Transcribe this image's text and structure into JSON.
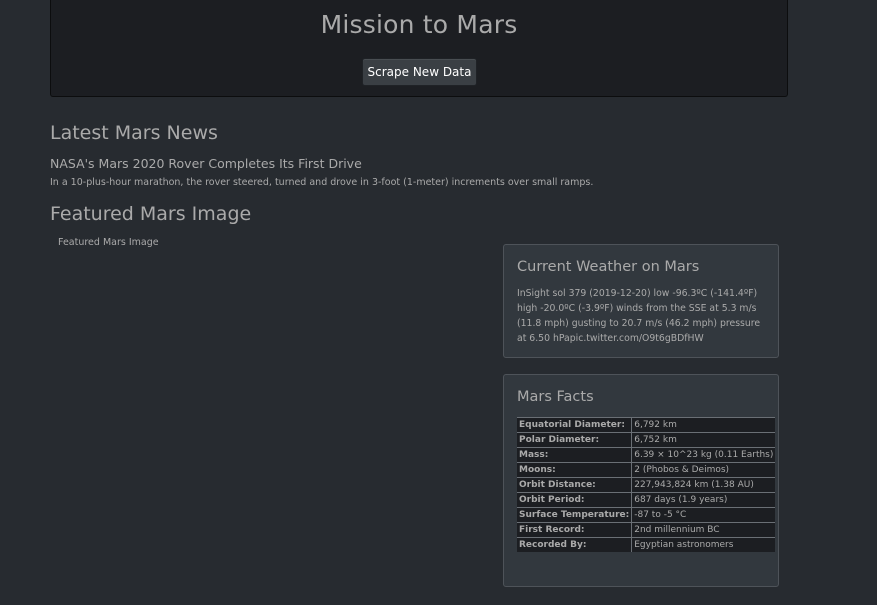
{
  "header": {
    "title": "Mission to Mars",
    "scrape_button_label": "Scrape New Data"
  },
  "news": {
    "section_title": "Latest Mars News",
    "headline": "NASA's Mars 2020 Rover Completes Its First Drive",
    "teaser": "In a 10-plus-hour marathon, the rover steered, turned and drove in 3-foot (1-meter) increments over small ramps."
  },
  "featured_image": {
    "section_title": "Featured Mars Image",
    "alt_text": "Featured Mars Image"
  },
  "weather": {
    "title": "Current Weather on Mars",
    "text": "InSight sol 379 (2019-12-20) low -96.3ºC (-141.4ºF) high -20.0ºC (-3.9ºF) winds from the SSE at 5.3 m/s (11.8 mph) gusting to 20.7 m/s (46.2 mph) pressure at 6.50 hPapic.twitter.com/O9t6gBDfHW"
  },
  "facts": {
    "title": "Mars Facts",
    "rows": [
      {
        "label": "Equatorial Diameter:",
        "value": "6,792 km"
      },
      {
        "label": "Polar Diameter:",
        "value": "6,752 km"
      },
      {
        "label": "Mass:",
        "value": "6.39 × 10^23 kg (0.11 Earths)"
      },
      {
        "label": "Moons:",
        "value": "2 (Phobos & Deimos)"
      },
      {
        "label": "Orbit Distance:",
        "value": "227,943,824 km (1.38 AU)"
      },
      {
        "label": "Orbit Period:",
        "value": "687 days (1.9 years)"
      },
      {
        "label": "Surface Temperature:",
        "value": "-87 to -5 °C"
      },
      {
        "label": "First Record:",
        "value": "2nd millennium BC"
      },
      {
        "label": "Recorded By:",
        "value": "Egyptian astronomers"
      }
    ]
  },
  "colors": {
    "background": "#272b30",
    "jumbotron": "#1c1e22",
    "panel": "#32383e",
    "text": "#aaaaaa"
  }
}
